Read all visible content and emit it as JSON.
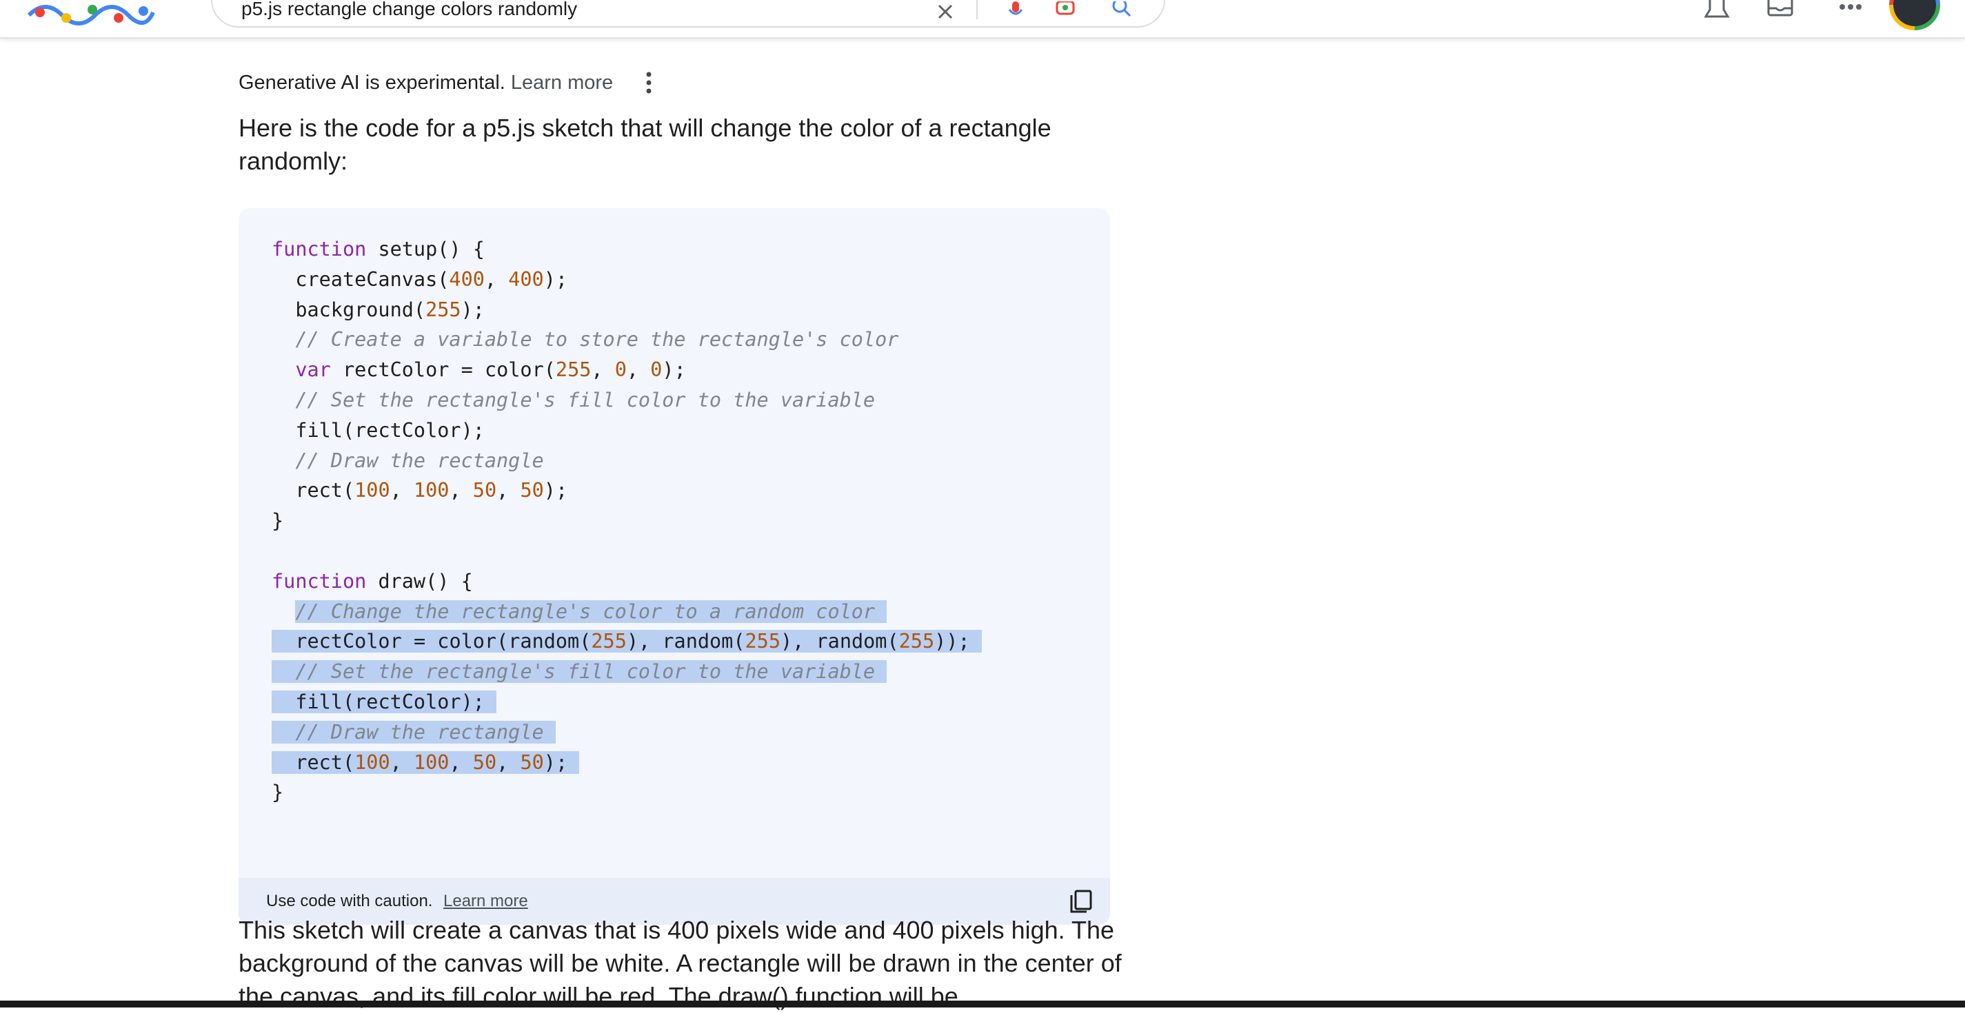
{
  "header": {
    "search_query": "p5.js rectangle change colors randomly",
    "icons": [
      "google-doodle",
      "close-icon",
      "microphone-icon",
      "lens-icon",
      "search-icon",
      "settings-icon",
      "labs-icon",
      "apps-grid-icon",
      "avatar"
    ]
  },
  "ai_overview": {
    "experimental_note": "Generative AI is experimental.",
    "learn_more": "Learn more",
    "intro": "Here is the code for a p5.js sketch that will change the color of a rectangle randomly:",
    "code_lines": [
      "function setup() {",
      "  createCanvas(400, 400);",
      "  background(255);",
      "  // Create a variable to store the rectangle's color",
      "  var rectColor = color(255, 0, 0);",
      "  // Set the rectangle's fill color to the variable",
      "  fill(rectColor);",
      "  // Draw the rectangle",
      "  rect(100, 100, 50, 50);",
      "}",
      "",
      "function draw() {",
      "  // Change the rectangle's color to a random color",
      "  rectColor = color(random(255), random(255), random(255));",
      "  // Set the rectangle's fill color to the variable",
      "  fill(rectColor);",
      "  // Draw the rectangle",
      "  rect(100, 100, 50, 50);",
      "}"
    ],
    "selected_line_range": [
      12,
      17
    ],
    "code_caution": "Use code with caution.",
    "code_learn_more": "Learn more",
    "explanation": "This sketch will create a canvas that is 400 pixels wide and 400 pixels high. The background of the canvas will be white. A rectangle will be drawn in the center of the canvas, and its fill color will be red. The draw() function will be"
  },
  "colors": {
    "code_bg": "#f3f6fc",
    "code_footer_bg": "#e7edf9",
    "selection": "#b9d0f3",
    "keyword": "#8e24aa",
    "number": "#b0540a",
    "comment": "#80868b"
  }
}
